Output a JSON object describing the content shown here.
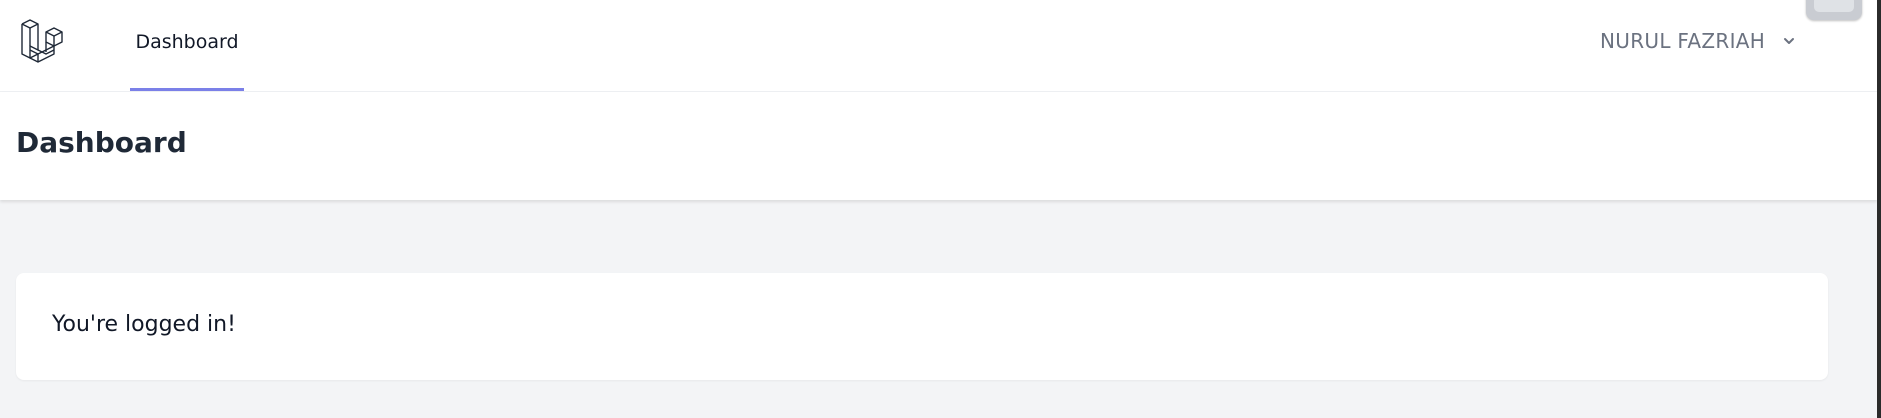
{
  "nav": {
    "logo_icon": "laravel-logo-icon",
    "links": [
      {
        "label": "Dashboard",
        "active": true
      }
    ],
    "active_color": "#7b80e8",
    "user_menu": {
      "name": "NURUL FAZRIAH",
      "icon": "chevron-down-icon"
    }
  },
  "header": {
    "title": "Dashboard"
  },
  "content": {
    "message": "You're logged in!"
  },
  "colors": {
    "page_background": "#f3f4f6",
    "surface": "#ffffff",
    "heading_text": "#1f2937",
    "muted_text": "#6b7280"
  }
}
